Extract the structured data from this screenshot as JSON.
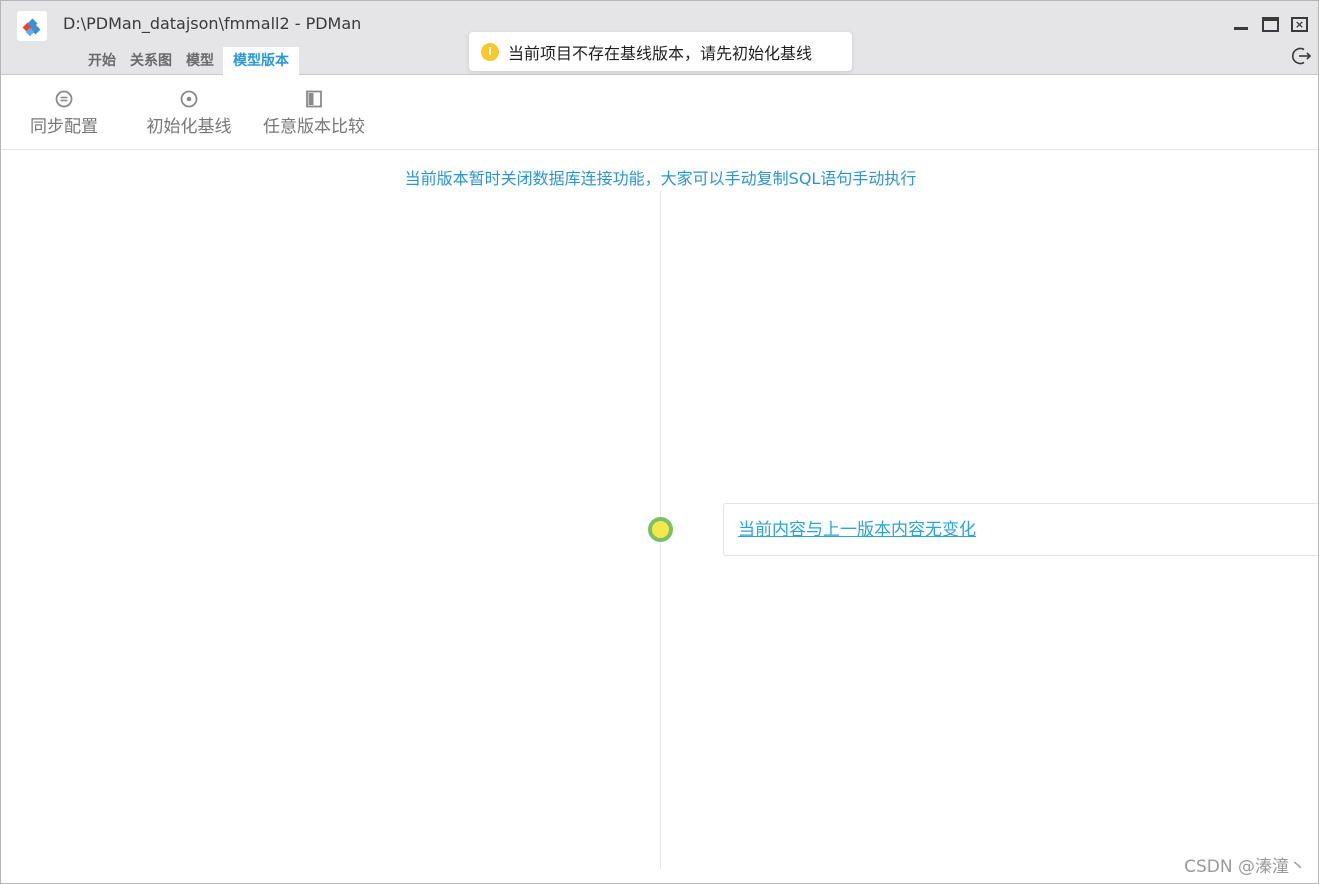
{
  "window": {
    "title": "D:\\PDMan_datajson\\fmmall2 - PDMan",
    "logo_icon": "pdman-logo-icon",
    "controls": [
      "minimize-icon",
      "maximize-icon",
      "close-icon"
    ],
    "exit_icon": "exit-icon"
  },
  "menu": {
    "tabs": [
      {
        "label": "开始",
        "active": false
      },
      {
        "label": "关系图",
        "active": false
      },
      {
        "label": "模型",
        "active": false
      },
      {
        "label": "模型版本",
        "active": true
      }
    ]
  },
  "toast": {
    "icon": "info-icon",
    "message": "当前项目不存在基线版本，请先初始化基线"
  },
  "toolbar": {
    "sync_label": "同步配置",
    "init_label": "初始化基线",
    "compare_label": "任意版本比较"
  },
  "content": {
    "notice": "当前版本暂时关闭数据库连接功能，大家可以手动复制SQL语句手动执行",
    "version_change_text": "当前内容与上一版本内容无变化"
  },
  "watermark": "CSDN @溱潼丶",
  "colors": {
    "accent": "#2b9ad8",
    "toast_icon": "#fac82e",
    "timeline_dot_fill": "#f5e84a",
    "timeline_dot_border": "#79c169"
  }
}
